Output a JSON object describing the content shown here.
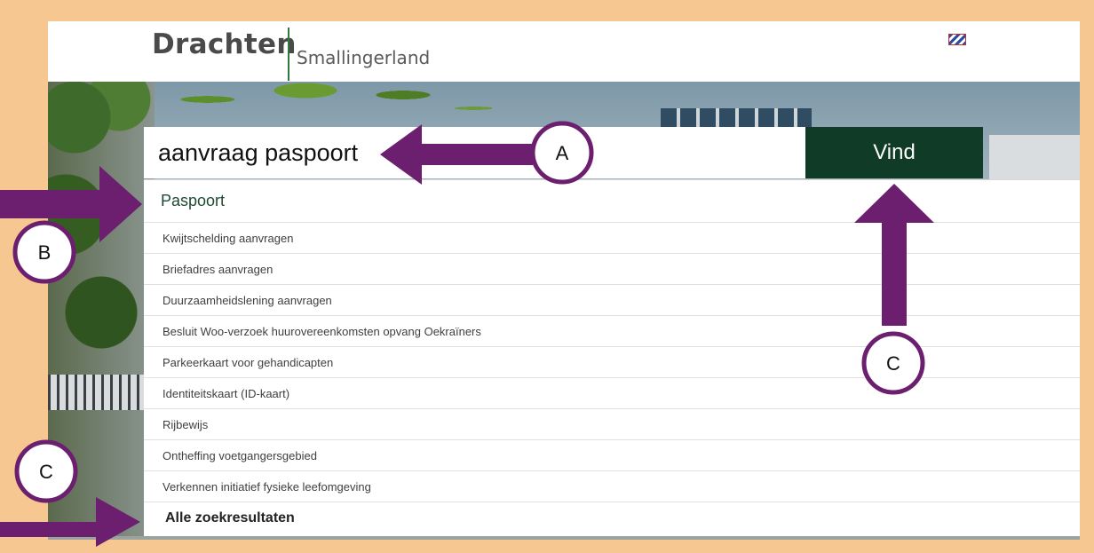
{
  "header": {
    "logo_main": "Drachten",
    "logo_sub": "Smallingerland",
    "flag_icon": "frisian-flag-icon"
  },
  "search": {
    "value": "aanvraag paspoort",
    "button_label": "Vind"
  },
  "results": {
    "top": "Paspoort",
    "items": [
      "Kwijtschelding aanvragen",
      "Briefadres aanvragen",
      "Duurzaamheidslening aanvragen",
      "Besluit Woo-verzoek huurovereenkomsten opvang Oekraïners",
      "Parkeerkaart voor gehandicapten",
      "Identiteitskaart (ID-kaart)",
      "Rijbewijs",
      "Ontheffing voetgangersgebied",
      "Verkennen initiatief fysieke leefomgeving"
    ],
    "all_label": "Alle zoekresultaten"
  },
  "annotations": {
    "marker_a": "A",
    "marker_b": "B",
    "marker_c1": "C",
    "marker_c2": "C",
    "arrow_color": "#6b1f6e",
    "frame_color": "#f6c790"
  }
}
